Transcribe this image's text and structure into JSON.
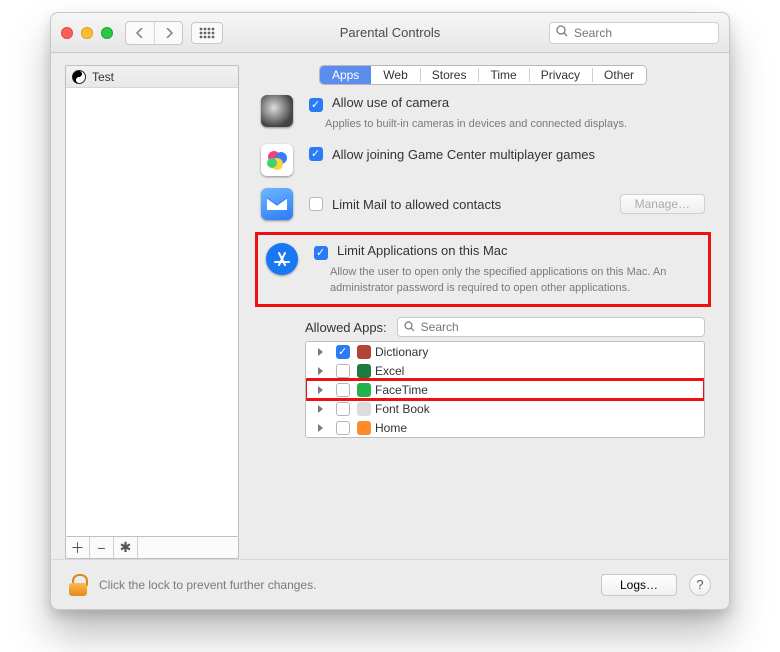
{
  "window": {
    "title": "Parental Controls"
  },
  "toolbar": {
    "search_placeholder": "Search"
  },
  "sidebar": {
    "users": [
      {
        "name": "Test"
      }
    ],
    "footer": {
      "add": "＋",
      "remove": "−",
      "gear": "✱"
    }
  },
  "tabs": {
    "items": [
      "Apps",
      "Web",
      "Stores",
      "Time",
      "Privacy",
      "Other"
    ],
    "active_index": 0
  },
  "options": {
    "camera": {
      "label": "Allow use of camera",
      "desc": "Applies to built-in cameras in devices and connected displays.",
      "checked": true
    },
    "gamecenter": {
      "label": "Allow joining Game Center multiplayer games",
      "checked": true
    },
    "mail": {
      "label": "Limit Mail to allowed contacts",
      "checked": false,
      "manage_label": "Manage…"
    },
    "limit_apps": {
      "label": "Limit Applications on this Mac",
      "desc": "Allow the user to open only the specified applications on this Mac. An administrator password is required to open other applications.",
      "checked": true
    }
  },
  "allowed_apps": {
    "title": "Allowed Apps:",
    "search_placeholder": "Search",
    "items": [
      {
        "name": "Dictionary",
        "checked": true,
        "color": "#b4443a"
      },
      {
        "name": "Excel",
        "checked": false,
        "color": "#1f7a3f"
      },
      {
        "name": "FaceTime",
        "checked": false,
        "color": "#22b24c",
        "highlight": true
      },
      {
        "name": "Font Book",
        "checked": false,
        "color": "#dcdcdc"
      },
      {
        "name": "Home",
        "checked": false,
        "color": "#ff8a2a"
      }
    ]
  },
  "footer": {
    "lock_text": "Click the lock to prevent further changes.",
    "logs_label": "Logs…",
    "help_label": "?"
  }
}
